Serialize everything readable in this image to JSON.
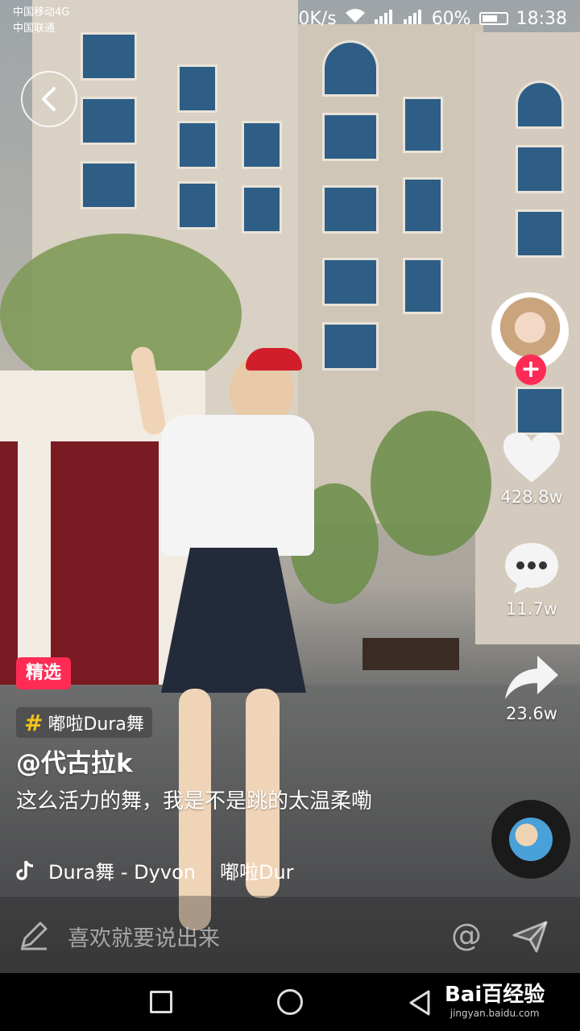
{
  "status_bar": {
    "carrier_1": "中国移动4G",
    "carrier_2": "中国联通",
    "network_speed": "0K/s",
    "battery": "60%",
    "time": "18:38"
  },
  "right_rail": {
    "likes": "428.8w",
    "comments": "11.7w",
    "shares": "23.6w",
    "follow_symbol": "+"
  },
  "video_info": {
    "featured_tag": "精选",
    "challenge_tag": "嘟啦Dura舞",
    "author": "@代古拉k",
    "caption": "这么活力的舞，我是不是跳的太温柔嘞",
    "music_part1": "Dura舞 - Dyvon",
    "music_part2": "嘟啦Dur"
  },
  "comment_bar": {
    "placeholder": "喜欢就要说出来",
    "at_symbol": "@"
  },
  "watermark": {
    "main": "Bai百经验",
    "sub": "jingyan.baidu.com"
  },
  "icons": [
    "back-icon",
    "heart-icon",
    "comment-icon",
    "share-icon",
    "music-note-icon",
    "pencil-icon",
    "send-icon",
    "wifi-icon",
    "signal-icon",
    "battery-icon"
  ],
  "colors": {
    "accent": "#fe2c55",
    "hashtag": "#f5c518"
  }
}
